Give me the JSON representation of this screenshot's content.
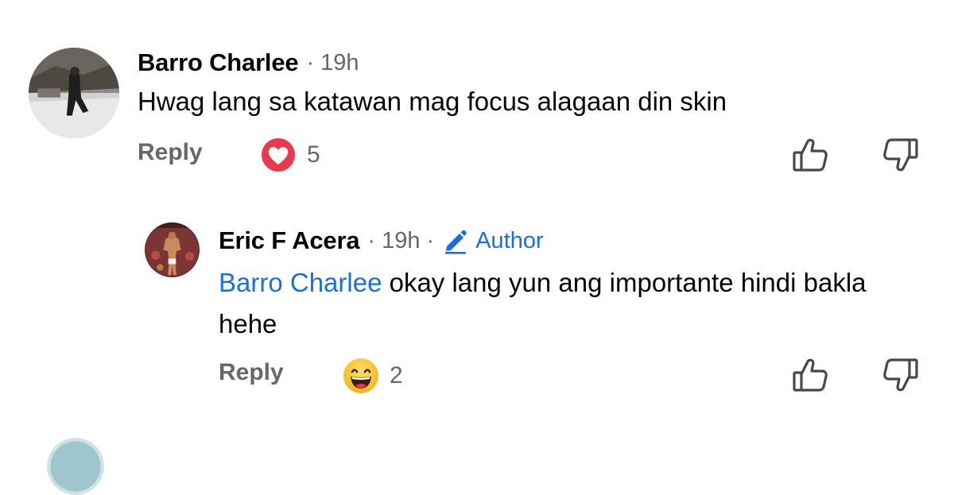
{
  "comments": [
    {
      "author": "Barro Charlee",
      "time": "· 19h",
      "text": "Hwag lang sa katawan mag focus alagaan din skin",
      "reply_label": "Reply",
      "reaction": {
        "icon": "heart-reaction-icon",
        "count": "5",
        "color": "#e8394d"
      },
      "like_icon": "thumbs-up-icon",
      "dislike_icon": "thumbs-down-icon"
    },
    {
      "author": "Eric F Acera",
      "time": "· 19h ·",
      "badge": "Author",
      "badge_icon": "pencil-icon",
      "mention": "Barro Charlee",
      "text": " okay lang yun ang importante hindi bakla hehe",
      "reply_label": "Reply",
      "reaction": {
        "icon": "laughing-emoji-icon",
        "count": "2"
      },
      "like_icon": "thumbs-up-icon",
      "dislike_icon": "thumbs-down-icon"
    }
  ],
  "colors": {
    "link": "#1b6fd8",
    "secondary": "#65676b",
    "text": "#050505"
  }
}
